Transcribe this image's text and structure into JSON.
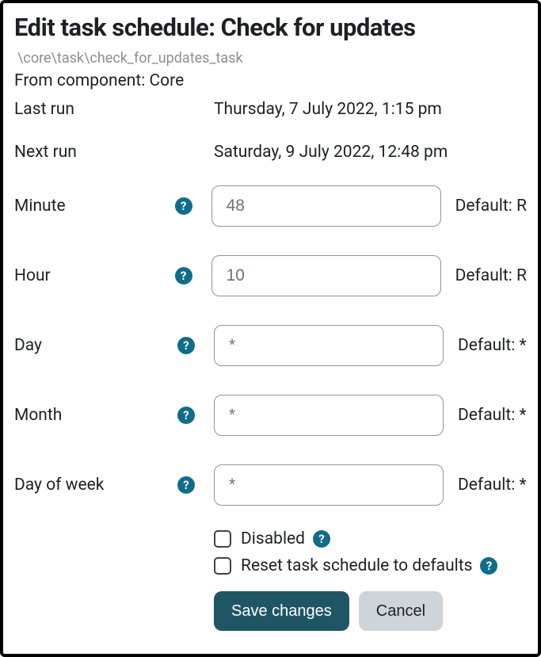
{
  "header": {
    "title": "Edit task schedule: Check for updates",
    "classpath": "\\core\\task\\check_for_updates_task",
    "component_label": "From component: Core"
  },
  "info": {
    "last_run_label": "Last run",
    "last_run_value": "Thursday, 7 July 2022, 1:15 pm",
    "next_run_label": "Next run",
    "next_run_value": "Saturday, 9 July 2022, 12:48 pm"
  },
  "fields": {
    "minute": {
      "label": "Minute",
      "value": "48",
      "hint": "Default: R"
    },
    "hour": {
      "label": "Hour",
      "value": "10",
      "hint": "Default: R"
    },
    "day": {
      "label": "Day",
      "value": "*",
      "hint": "Default: *"
    },
    "month": {
      "label": "Month",
      "value": "*",
      "hint": "Default: *"
    },
    "dow": {
      "label": "Day of week",
      "value": "*",
      "hint": "Default: *"
    }
  },
  "checkboxes": {
    "disabled_label": "Disabled",
    "reset_label": "Reset task schedule to defaults"
  },
  "buttons": {
    "save": "Save changes",
    "cancel": "Cancel"
  },
  "icons": {
    "help": "?"
  }
}
